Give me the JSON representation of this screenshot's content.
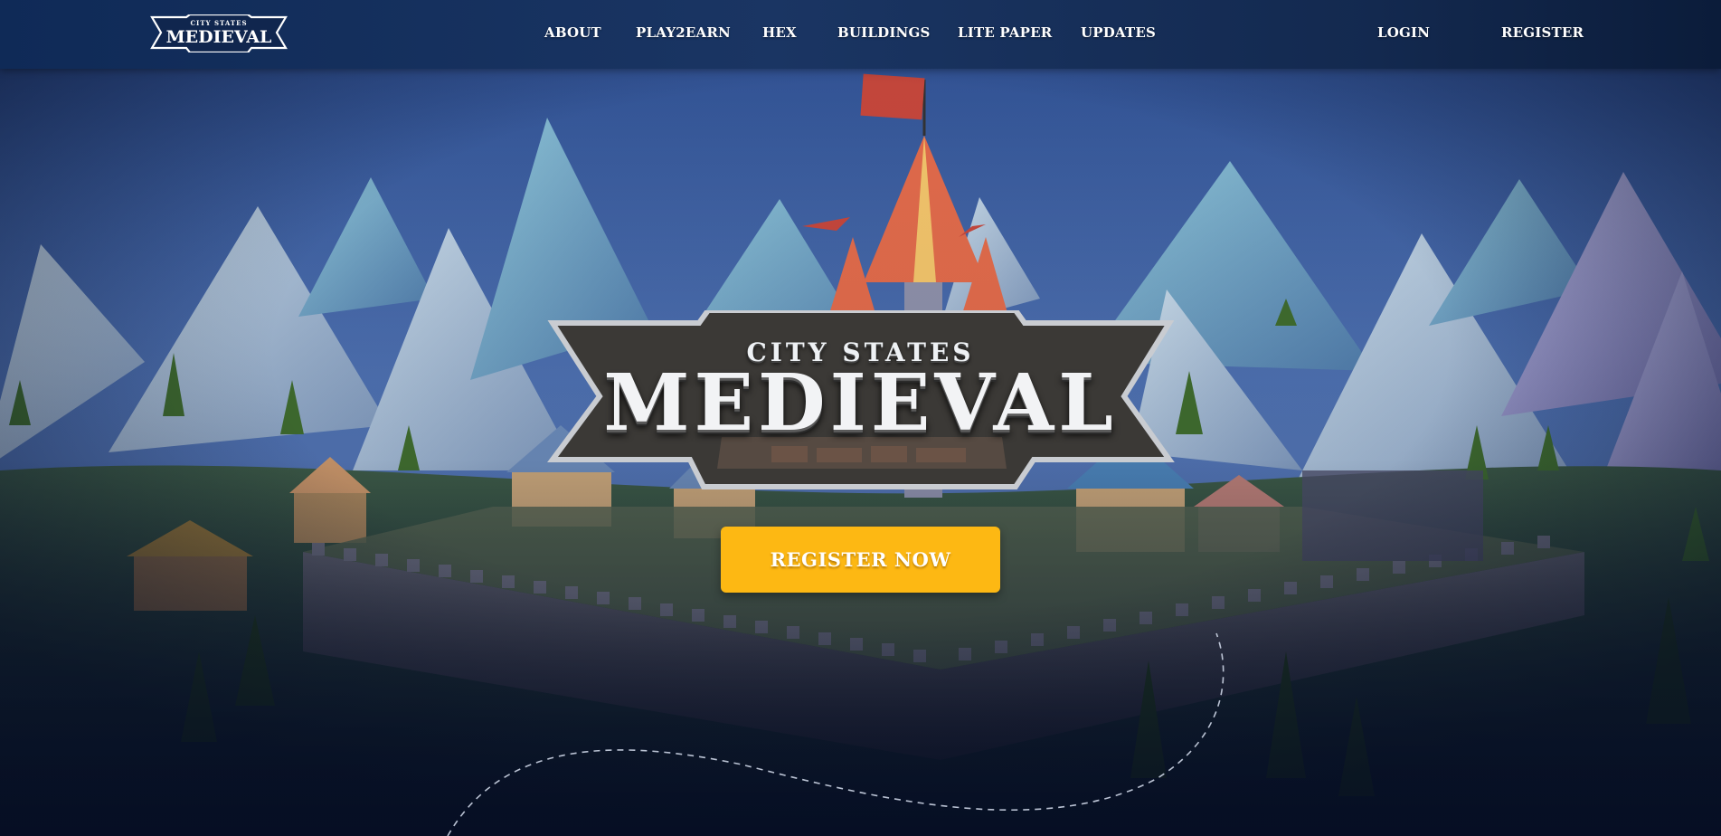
{
  "nav": {
    "logo_subtitle": "CITY STATES",
    "logo_title": "MEDIEVAL",
    "links": [
      "ABOUT",
      "PLAY2EARN",
      "HEX",
      "BUILDINGS",
      "LITE PAPER",
      "UPDATES"
    ],
    "login_label": "LOGIN",
    "register_label": "REGISTER"
  },
  "hero": {
    "logo_subtitle": "CITY STATES",
    "logo_title": "MEDIEVAL",
    "cta_label": "REGISTER NOW"
  },
  "colors": {
    "nav_background": "#15305c",
    "cta_background": "#fdb813",
    "sky": "#4a6aa8"
  },
  "icons": {
    "logo": "city-states-medieval-logo-banner",
    "castle_flag": "flag-icon"
  }
}
